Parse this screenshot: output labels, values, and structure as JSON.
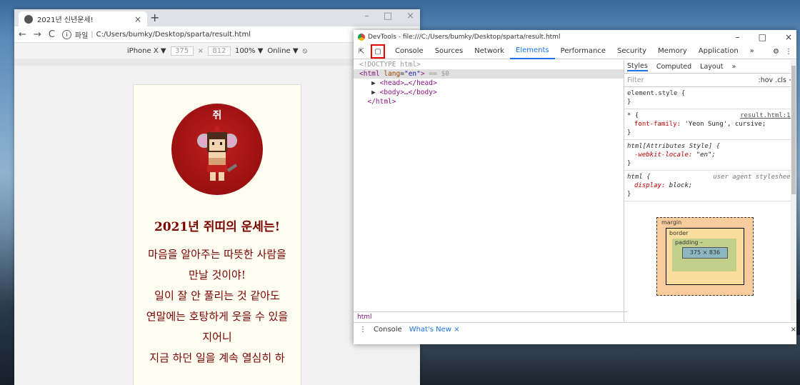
{
  "browser": {
    "tab_title": "2021년 신년운세!",
    "tab_close": "×",
    "new_tab": "+",
    "url_prefix": "파일",
    "url": "C:/Users/bumky/Desktop/sparta/result.html",
    "device": "iPhone X ▼",
    "width": "375",
    "height": "812",
    "zoom": "100% ▼",
    "network": "Online ▼"
  },
  "page": {
    "animal_label": "쥐",
    "fortune_title": "2021년 쥐띠의 운세는!",
    "fortune_lines": [
      "마음을 알아주는 따뜻한 사람을",
      "만날 것이야!",
      "일이 잘 안 풀리는 것 같아도",
      "연말에는 호탕하게 웃을 수 있을",
      "지어니",
      "지금 하던 일을 계속 열심히 하"
    ]
  },
  "devtools": {
    "title": "DevTools - file:///C:/Users/bumky/Desktop/sparta/result.html",
    "tabs": [
      "Console",
      "Sources",
      "Network",
      "Elements",
      "Performance",
      "Security",
      "Memory",
      "Application",
      "»"
    ],
    "active_tab": "Elements",
    "style_tabs": [
      "Styles",
      "Computed",
      "Layout",
      "»"
    ],
    "filter_placeholder": "Filter",
    "filter_opts": ":hov  .cls  +",
    "breadcrumb": "html",
    "bottom_tabs": [
      "Console",
      "What's New ×"
    ],
    "box": {
      "margin": "margin",
      "border": "border",
      "padding": "padding –",
      "content": "375 × 836",
      "dash": "–"
    }
  },
  "elements_tree": {
    "doctype": "<!DOCTYPE html>",
    "html_open": "<html",
    "lang_attr": "lang",
    "lang_val": "\"en\"",
    "sel_marker": "== $0",
    "head": "<head>…</head>",
    "body": "<body>…</body>",
    "html_close": "</html>"
  },
  "styles_rules": {
    "r1_sel": "element.style {",
    "r1_close": "}",
    "r2_sel": "* {",
    "r2_src": "result.html:13",
    "r2_prop": "font-family",
    "r2_val": "'Yeon Sung', cursive;",
    "r3_sel": "html[Attributes Style] {",
    "r3_prop": "-webkit-locale",
    "r3_val": "\"en\";",
    "r4_sel": "html {",
    "r4_src": "user agent stylesheet",
    "r4_prop": "display",
    "r4_val": "block;"
  }
}
